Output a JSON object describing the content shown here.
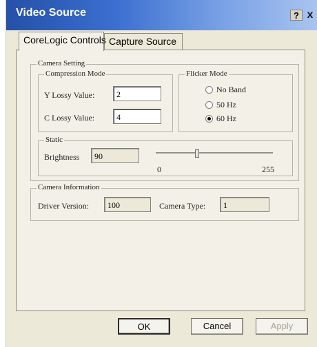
{
  "window": {
    "title": "Video Source",
    "help_label": "?",
    "close_label": "x"
  },
  "tabs": [
    {
      "label": "CoreLogic Controls",
      "active": true
    },
    {
      "label": "Capture Source",
      "active": false
    }
  ],
  "camera_setting": {
    "label": "Camera Setting",
    "compression_mode": {
      "label": "Compression Mode",
      "y_lossy": {
        "label": "Y Lossy Value:",
        "value": "2"
      },
      "c_lossy": {
        "label": "C Lossy Value:",
        "value": "4"
      }
    },
    "flicker_mode": {
      "label": "Flicker Mode",
      "options": [
        {
          "label": "No Band",
          "selected": false
        },
        {
          "label": "50 Hz",
          "selected": false
        },
        {
          "label": "60 Hz",
          "selected": true
        }
      ]
    },
    "static": {
      "label": "Static",
      "brightness": {
        "label": "Brightness",
        "value": "90"
      },
      "slider": {
        "min_label": "0",
        "max_label": "255",
        "min": 0,
        "max": 255,
        "value": 90
      }
    }
  },
  "camera_information": {
    "label": "Camera Information",
    "driver_version": {
      "label": "Driver Version:",
      "value": "100"
    },
    "camera_type": {
      "label": "Camera Type:",
      "value": "1"
    }
  },
  "buttons": {
    "ok": "OK",
    "cancel": "Cancel",
    "apply": "Apply"
  },
  "colors": {
    "title_bar_start": "#2450a8",
    "dialog_background": "#ece9d8"
  }
}
